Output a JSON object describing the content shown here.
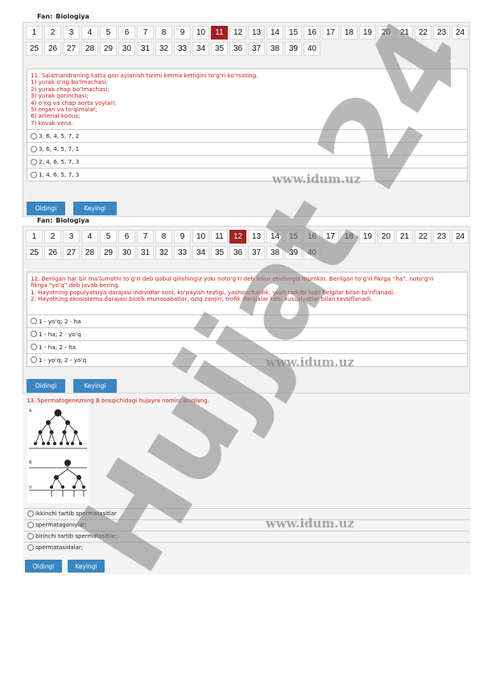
{
  "fan_label": "Fan:",
  "fan_value": "Biologiya",
  "numbers": [
    "1",
    "2",
    "3",
    "4",
    "5",
    "6",
    "7",
    "8",
    "9",
    "10",
    "11",
    "12",
    "13",
    "14",
    "15",
    "16",
    "17",
    "18",
    "19",
    "20",
    "21",
    "22",
    "23",
    "24",
    "25",
    "26",
    "27",
    "28",
    "29",
    "30",
    "31",
    "32",
    "33",
    "34",
    "35",
    "36",
    "37",
    "38",
    "39",
    "40"
  ],
  "watermark": "www.idum.uz",
  "diagonal_watermark": "Hujjat 24",
  "buttons": {
    "prev": "Oldingi",
    "next": "Keyingi"
  },
  "q11": {
    "active": "11",
    "lines": [
      "11.  Salamandraning katta qon aylanish tizimi ketma ketligini to‘g‘ri ko‘rsating.",
      "1) yurak o‘ng bo‘lmachasi;",
      "2) yurak chap bo‘lmachasi;",
      "3) yurak qorinchasi;",
      "4) o‘ng va chap aorta yoylari;",
      "5) organ va to‘qimalar;",
      "6) arterial konus;",
      "7) kovak vena."
    ],
    "options": [
      "3, 6, 4, 5, 7, 2",
      "3, 6, 4, 5, 7, 1",
      "2, 4, 6, 5, 7, 3",
      "1, 4, 6, 5, 7, 3"
    ]
  },
  "q12": {
    "active": "12",
    "lines": [
      "12.  Berilgan har bir ma’lumotni to‘g‘ri deb qabul qilishingiz yoki noto‘g‘ri deb inkor etishingiz mumkin. Berilgan to‘g‘ri fikrga “ha”, noto‘g‘ri",
      "fikrga “yo‘q” deb javob bering.",
      "1. Hayotning populyatsiya darajasi individlar soni, ko‘payish tezligi, yashovchanlik, yosh tarkibi kabi belgilar bilan ta’riflanadi.",
      "2. Hayotning ekosistema darajasi biotik munosabatlar, oziq zanjiri, trofik darajalar kabi xususiyatlar bilan tavsiflanadi."
    ],
    "options": [
      "1 - yo‘q; 2 - ha",
      "1 - ha; 2 - yo‘q",
      "1 - ha; 2 - ha",
      "1 - yo‘q; 2 - yo‘q"
    ]
  },
  "q13": {
    "text": "13.  Spermatogenezning B bosqichidagi hujayra nomini aniqlang.",
    "diagram_labels": [
      "A",
      "B",
      "V"
    ],
    "options": [
      "ikkinchi tartib spermatasitlar",
      "spermatagoniylar;",
      "birinchi tartib spermatasitlar;",
      "spermatasidalar;"
    ]
  }
}
